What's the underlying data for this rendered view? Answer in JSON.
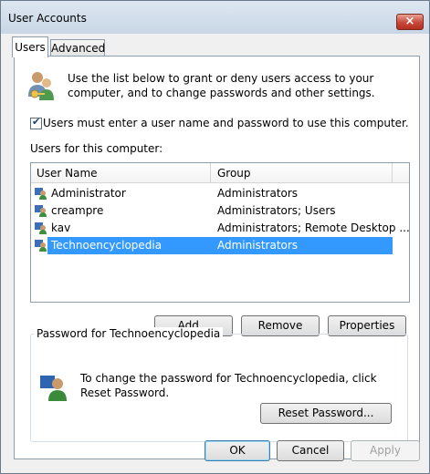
{
  "window": {
    "title": "User Accounts",
    "close_label": "×"
  },
  "tabs": [
    {
      "label": "Users"
    },
    {
      "label": "Advanced"
    }
  ],
  "users_tab": {
    "intro_text": "Use the list below to grant or deny users access to your computer, and to change passwords and other settings.",
    "checkbox_label": "Users must enter a user name and password to use this computer.",
    "checkbox_checked": true,
    "list_label": "Users for this computer:",
    "columns": {
      "name": "User Name",
      "group": "Group"
    },
    "rows": [
      {
        "name": "Administrator",
        "group": "Administrators"
      },
      {
        "name": "creampre",
        "group": "Administrators; Users"
      },
      {
        "name": "kav",
        "group": "Administrators; Remote Desktop ..."
      },
      {
        "name": "Technoencyclopedia",
        "group": "Administrators",
        "selected": true
      }
    ],
    "buttons": {
      "add": "Add...",
      "remove": "Remove",
      "properties": "Properties"
    },
    "password_group": {
      "title": "Password for Technoencyclopedia",
      "text": "To change the password for Technoencyclopedia, click Reset Password.",
      "reset_button": "Reset Password..."
    }
  },
  "footer": {
    "ok": "OK",
    "cancel": "Cancel",
    "apply": "Apply",
    "apply_enabled": false
  },
  "colors": {
    "selection": "#3399ff",
    "close_button": "#c8473a"
  }
}
